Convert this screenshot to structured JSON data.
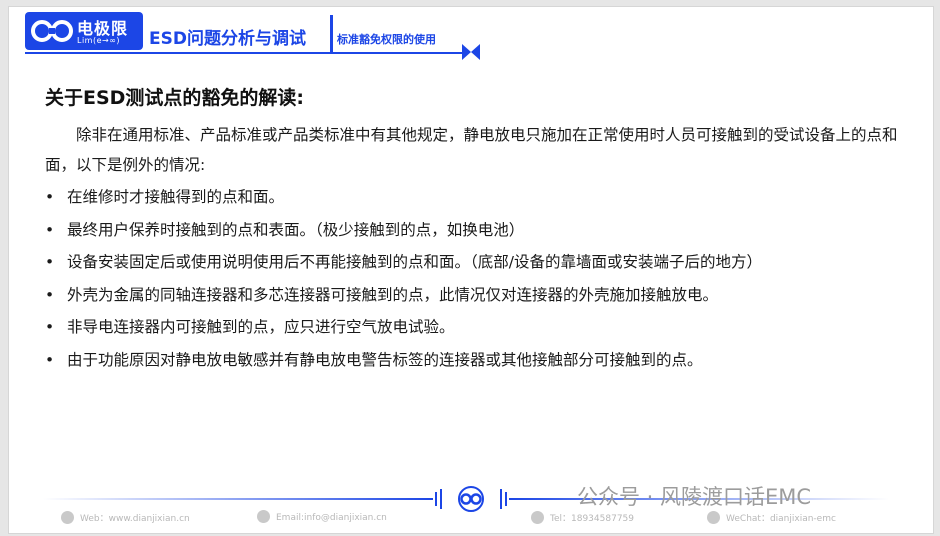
{
  "header": {
    "logo_cn": "电极限",
    "logo_en": "Lim(e→∞)",
    "title": "ESD问题分析与调试",
    "subtitle": "标准豁免权限的使用"
  },
  "content": {
    "title": "关于ESD测试点的豁免的解读:",
    "intro": "除非在通用标准、产品标准或产品类标准中有其他规定，静电放电只施加在正常使用时人员可接触到的受试设备上的点和面，以下是例外的情况:",
    "bullet_symbol": "•",
    "bullets": [
      "在维修时才接触得到的点和面。",
      "最终用户保养时接触到的点和表面。（极少接触到的点，如换电池）",
      "设备安装固定后或使用说明使用后不再能接触到的点和面。（底部/设备的靠墙面或安装端子后的地方）",
      "外壳为金属的同轴连接器和多芯连接器可接触到的点，此情况仅对连接器的外壳施加接触放电。",
      "非导电连接器内可接触到的点，应只进行空气放电试验。",
      "由于功能原因对静电放电敏感并有静电放电警告标签的连接器或其他接触部分可接触到的点。"
    ]
  },
  "footer": {
    "web": "Web：www.dianjixian.cn",
    "email": "Email:info@dianjixian.cn",
    "tel": "Tel：18934587759",
    "wechat": "WeChat：dianjixian-emc"
  },
  "watermark": "公众号 · 风陵渡口话EMC",
  "colors": {
    "brand": "#1c46e6",
    "text": "#1a1a1a",
    "footer_text": "#b8b8b8"
  }
}
